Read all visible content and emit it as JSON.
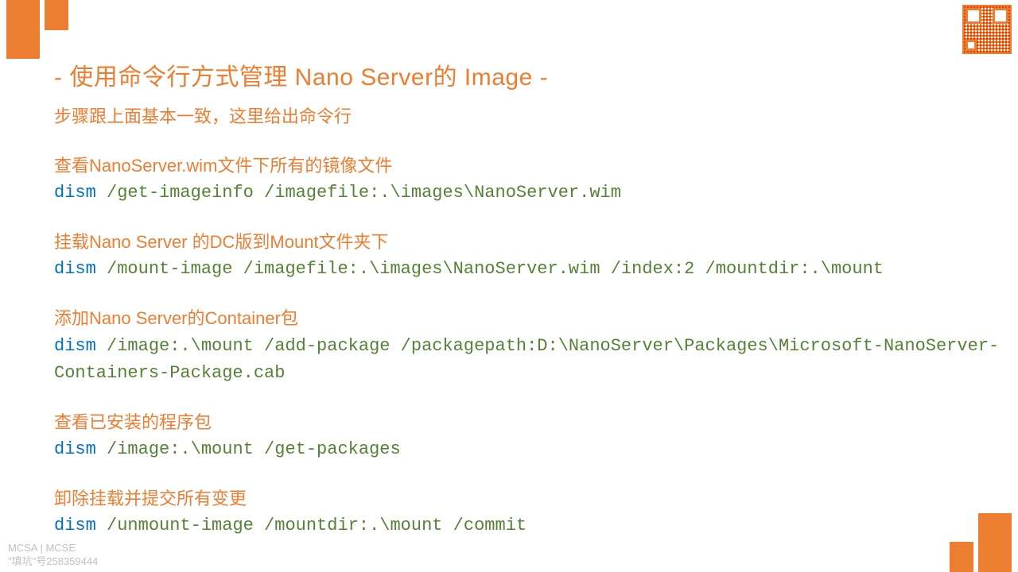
{
  "title": "- 使用命令行方式管理 Nano Server的 Image -",
  "intro": "步骤跟上面基本一致，这里给出命令行",
  "sections": [
    {
      "desc": "查看NanoServer.wim文件下所有的镜像文件",
      "cmd_prefix": "dism",
      "cmd_args": " /get-imageinfo /imagefile:.\\images\\NanoServer.wim"
    },
    {
      "desc": "挂载Nano Server 的DC版到Mount文件夹下",
      "cmd_prefix": "dism",
      "cmd_args": " /mount-image /imagefile:.\\images\\NanoServer.wim /index:2 /mountdir:.\\mount"
    },
    {
      "desc": "添加Nano Server的Container包",
      "cmd_prefix": "dism",
      "cmd_args": " /image:.\\mount /add-package /packagepath:D:\\NanoServer\\Packages\\Microsoft-NanoServer-Containers-Package.cab"
    },
    {
      "desc": "查看已安装的程序包",
      "cmd_prefix": "dism",
      "cmd_args": " /image:.\\mount /get-packages"
    },
    {
      "desc": "卸除挂载并提交所有变更",
      "cmd_prefix": "dism",
      "cmd_args": " /unmount-image /mountdir:.\\mount /commit"
    }
  ],
  "footer": {
    "line1": "MCSA | MCSE",
    "line2": "\"填坑\"号258359444"
  }
}
